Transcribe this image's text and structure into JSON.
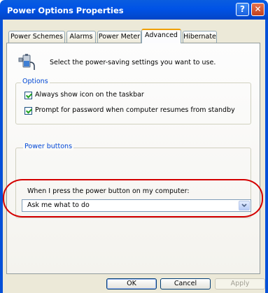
{
  "window": {
    "title": "Power Options Properties",
    "help_glyph": "?",
    "close_glyph": "✕"
  },
  "tabs": [
    {
      "label": "Power Schemes"
    },
    {
      "label": "Alarms"
    },
    {
      "label": "Power Meter"
    },
    {
      "label": "Advanced",
      "active": true
    },
    {
      "label": "Hibernate"
    }
  ],
  "intro": {
    "text": "Select the power-saving settings you want to use.",
    "icon": "battery-plug-icon"
  },
  "options": {
    "title": "Options",
    "items": [
      {
        "label": "Always show icon on the taskbar",
        "checked": true
      },
      {
        "label": "Prompt for password when computer resumes from standby",
        "checked": true
      }
    ]
  },
  "power_buttons": {
    "title": "Power buttons",
    "prompt": "When I press the power button on my computer:",
    "selected": "Ask me what to do"
  },
  "buttons": {
    "ok": "OK",
    "cancel": "Cancel",
    "apply": "Apply"
  },
  "colors": {
    "titlebar": "#0053e6",
    "highlight_oval": "#d40000",
    "group_label": "#0046d5"
  }
}
